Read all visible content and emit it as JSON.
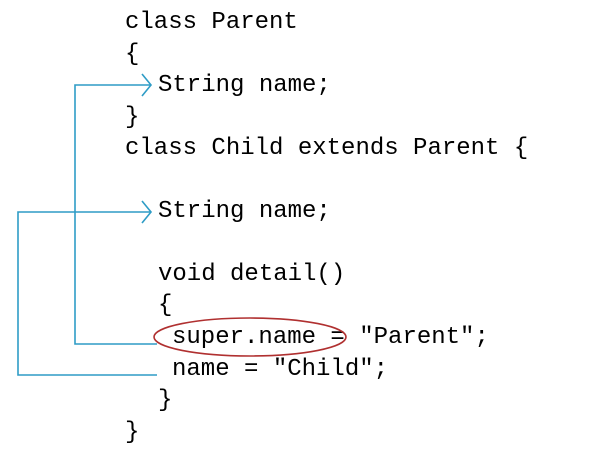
{
  "code": {
    "line_1": "class Parent",
    "line_2": "{",
    "line_3": "String name;",
    "line_4": "}",
    "line_5": "class Child extends Parent {",
    "line_6": "String name;",
    "line_7": "void detail()",
    "line_8": "{",
    "line_9_super": "super.name",
    "line_9_rest": " = \"Parent\";",
    "line_10": "name = \"Child\";",
    "line_11": "}",
    "line_12": "}"
  },
  "colors": {
    "arrow": "#2e9cc6",
    "highlight_ellipse": "#b03030",
    "text": "#000000",
    "background": "#ffffff"
  }
}
